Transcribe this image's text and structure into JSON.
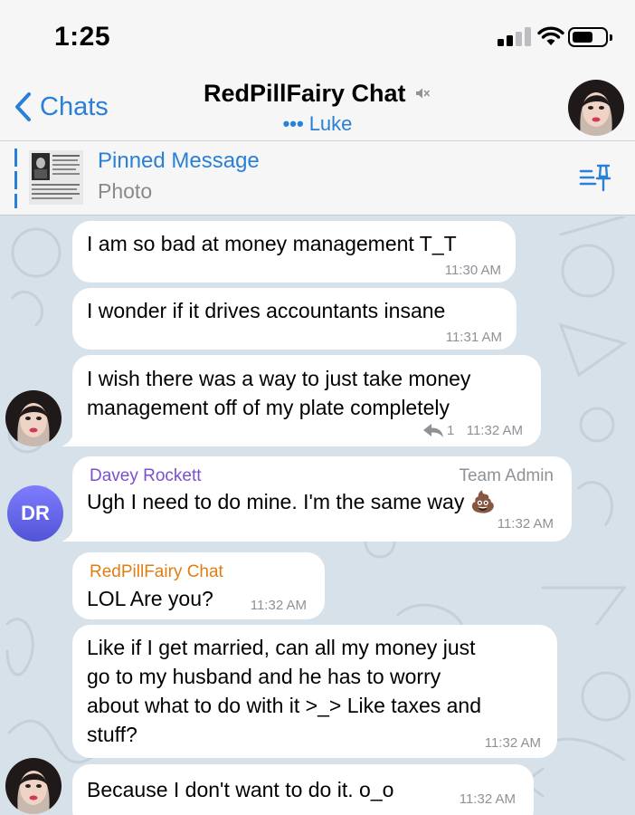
{
  "status_bar": {
    "time": "1:25",
    "battery_level": 0.65
  },
  "header": {
    "back_label": "Chats",
    "title": "RedPillFairy Chat",
    "typing_dots": "•••",
    "subtitle": "Luke"
  },
  "pinned": {
    "title": "Pinned Message",
    "subtitle": "Photo"
  },
  "colors": {
    "accent": "#2a7fd6",
    "admin_name": "#7a4fd0",
    "group_name": "#e07e12",
    "wallpaper": "#d6e1ea"
  },
  "messages": [
    {
      "text": "I am so bad at money management T_T",
      "time": "11:30 AM"
    },
    {
      "text": "I wonder if it drives accountants insane",
      "time": "11:31 AM"
    },
    {
      "text": "I wish there was a way to just take money\nmanagement off of my plate completely",
      "time": "11:32 AM",
      "replies": "1"
    },
    {
      "sender": "Davey Rockett",
      "role": "Team Admin",
      "initials": "DR",
      "text": "Ugh I need to do mine. I'm the same way",
      "emoji": "💩",
      "time": "11:32 AM"
    },
    {
      "sender": "RedPillFairy Chat",
      "text": "LOL Are you?",
      "time": "11:32 AM"
    },
    {
      "text": "Like if I get married, can all my money just\ngo to my husband and he has to worry\nabout what to do with it >_> Like taxes and\nstuff?",
      "time": "11:32 AM"
    },
    {
      "text": "Because I don't want to do it. o_o",
      "time": "11:32 AM"
    }
  ]
}
